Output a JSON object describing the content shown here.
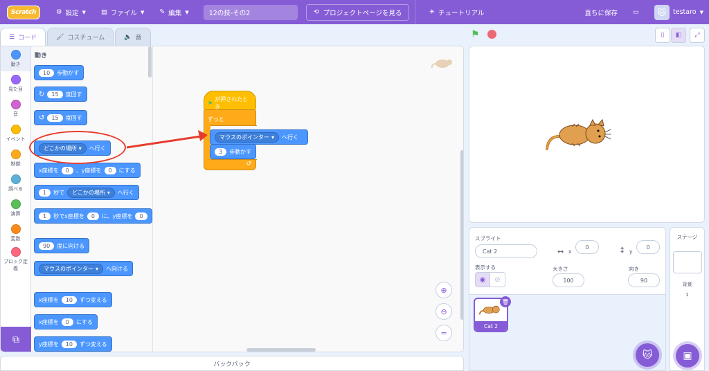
{
  "menu": {
    "logo": "Scratch",
    "settings": "設定",
    "file": "ファイル",
    "edit": "編集",
    "project_title": "12の技-その2",
    "project_page": "プロジェクトページを見る",
    "tutorial": "チュートリアル",
    "save_now": "直ちに保存",
    "username": "testaro"
  },
  "tabs": {
    "code": "コード",
    "costume": "コスチューム",
    "sound": "音"
  },
  "categories": [
    {
      "label": "動き",
      "color": "#4c97ff"
    },
    {
      "label": "見た目",
      "color": "#9966ff"
    },
    {
      "label": "音",
      "color": "#cf63cf"
    },
    {
      "label": "イベント",
      "color": "#ffbf00"
    },
    {
      "label": "制御",
      "color": "#ffab19"
    },
    {
      "label": "調べる",
      "color": "#5cb1d6"
    },
    {
      "label": "演算",
      "color": "#59c059"
    },
    {
      "label": "変数",
      "color": "#ff8c1a"
    },
    {
      "label": "ブロック定義",
      "color": "#ff6680"
    }
  ],
  "palette": {
    "title": "動き",
    "b1": {
      "num": "10",
      "text": "歩動かす"
    },
    "b2": {
      "num": "15",
      "text": "度回す"
    },
    "b3": {
      "num": "15",
      "text": "度回す"
    },
    "b4": {
      "drop": "どこかの場所",
      "text": "へ行く"
    },
    "b5": {
      "t1": "x座標を",
      "x": "0",
      "t2": "、y座標を",
      "y": "0",
      "t3": "にする"
    },
    "b6": {
      "num": "1",
      "t1": "秒で",
      "drop": "どこかの場所",
      "t2": "へ行く"
    },
    "b7": {
      "num": "1",
      "t1": "秒でx座標を",
      "x": "0",
      "t2": "に、y座標を",
      "y": "0"
    },
    "b8": {
      "num": "90",
      "text": "度に向ける"
    },
    "b9": {
      "drop": "マウスのポインター",
      "text": "へ向ける"
    },
    "b10": {
      "t1": "x座標を",
      "num": "10",
      "t2": "ずつ変える"
    },
    "b11": {
      "t1": "x座標を",
      "num": "0",
      "t2": "にする"
    },
    "b12": {
      "t1": "y座標を",
      "num": "10",
      "t2": "ずつ変える"
    }
  },
  "script": {
    "hat": "が押されたとき",
    "forever": "ずっと",
    "goto_drop": "マウスのポインター",
    "goto_text": "へ行く",
    "move_num": "3",
    "move_text": "歩動かす"
  },
  "backpack": "バックパック",
  "sprite": {
    "label": "スプライト",
    "name": "Cat 2",
    "x_label": "x",
    "x": "0",
    "y_label": "y",
    "y": "0",
    "show_label": "表示する",
    "size_label": "大きさ",
    "size": "100",
    "direction_label": "向き",
    "direction": "90",
    "tile_name": "Cat 2"
  },
  "stage_panel": {
    "title": "ステージ",
    "backdrops_label": "背景",
    "backdrops_count": "1"
  },
  "colors": {
    "accent": "#855cd6",
    "motion": "#4c97ff",
    "events": "#ffbf00",
    "control": "#ffab19",
    "callout": "#e63c2d"
  }
}
